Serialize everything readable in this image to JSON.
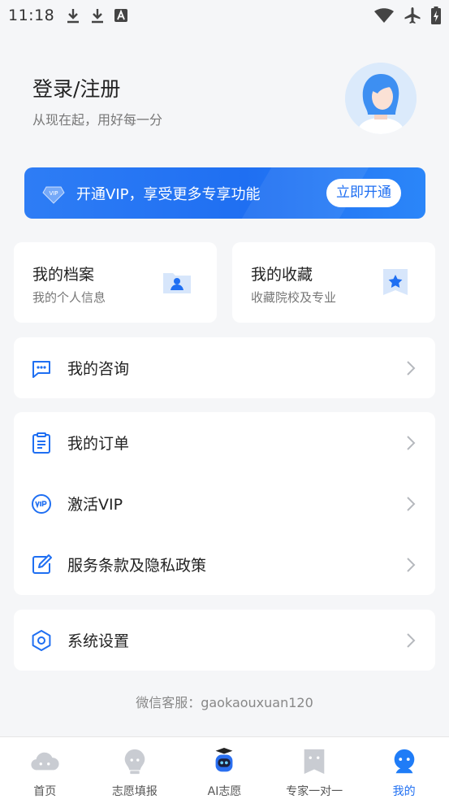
{
  "status_bar": {
    "time": "11:18"
  },
  "profile": {
    "title": "登录/注册",
    "subtitle": "从现在起，用好每一分"
  },
  "vip_banner": {
    "text": "开通VIP，享受更多专享功能",
    "button": "立即开通",
    "badge": "VIP"
  },
  "quick_cards": [
    {
      "title": "我的档案",
      "subtitle": "我的个人信息"
    },
    {
      "title": "我的收藏",
      "subtitle": "收藏院校及专业"
    }
  ],
  "menu": {
    "consult": "我的咨询",
    "orders": "我的订单",
    "activate_vip": "激活VIP",
    "terms": "服务条款及隐私政策",
    "settings": "系统设置"
  },
  "wechat": "微信客服：gaokaouxuan120",
  "tabs": [
    {
      "label": "首页",
      "icon": "cloud-icon"
    },
    {
      "label": "志愿填报",
      "icon": "bulb-icon"
    },
    {
      "label": "AI志愿",
      "icon": "robot-icon"
    },
    {
      "label": "专家一对一",
      "icon": "bookmark-icon"
    },
    {
      "label": "我的",
      "icon": "profile-icon"
    }
  ],
  "colors": {
    "accent": "#1f6ff2",
    "background": "#f5f6f8",
    "inactive_tab": "#c9ccd2"
  }
}
